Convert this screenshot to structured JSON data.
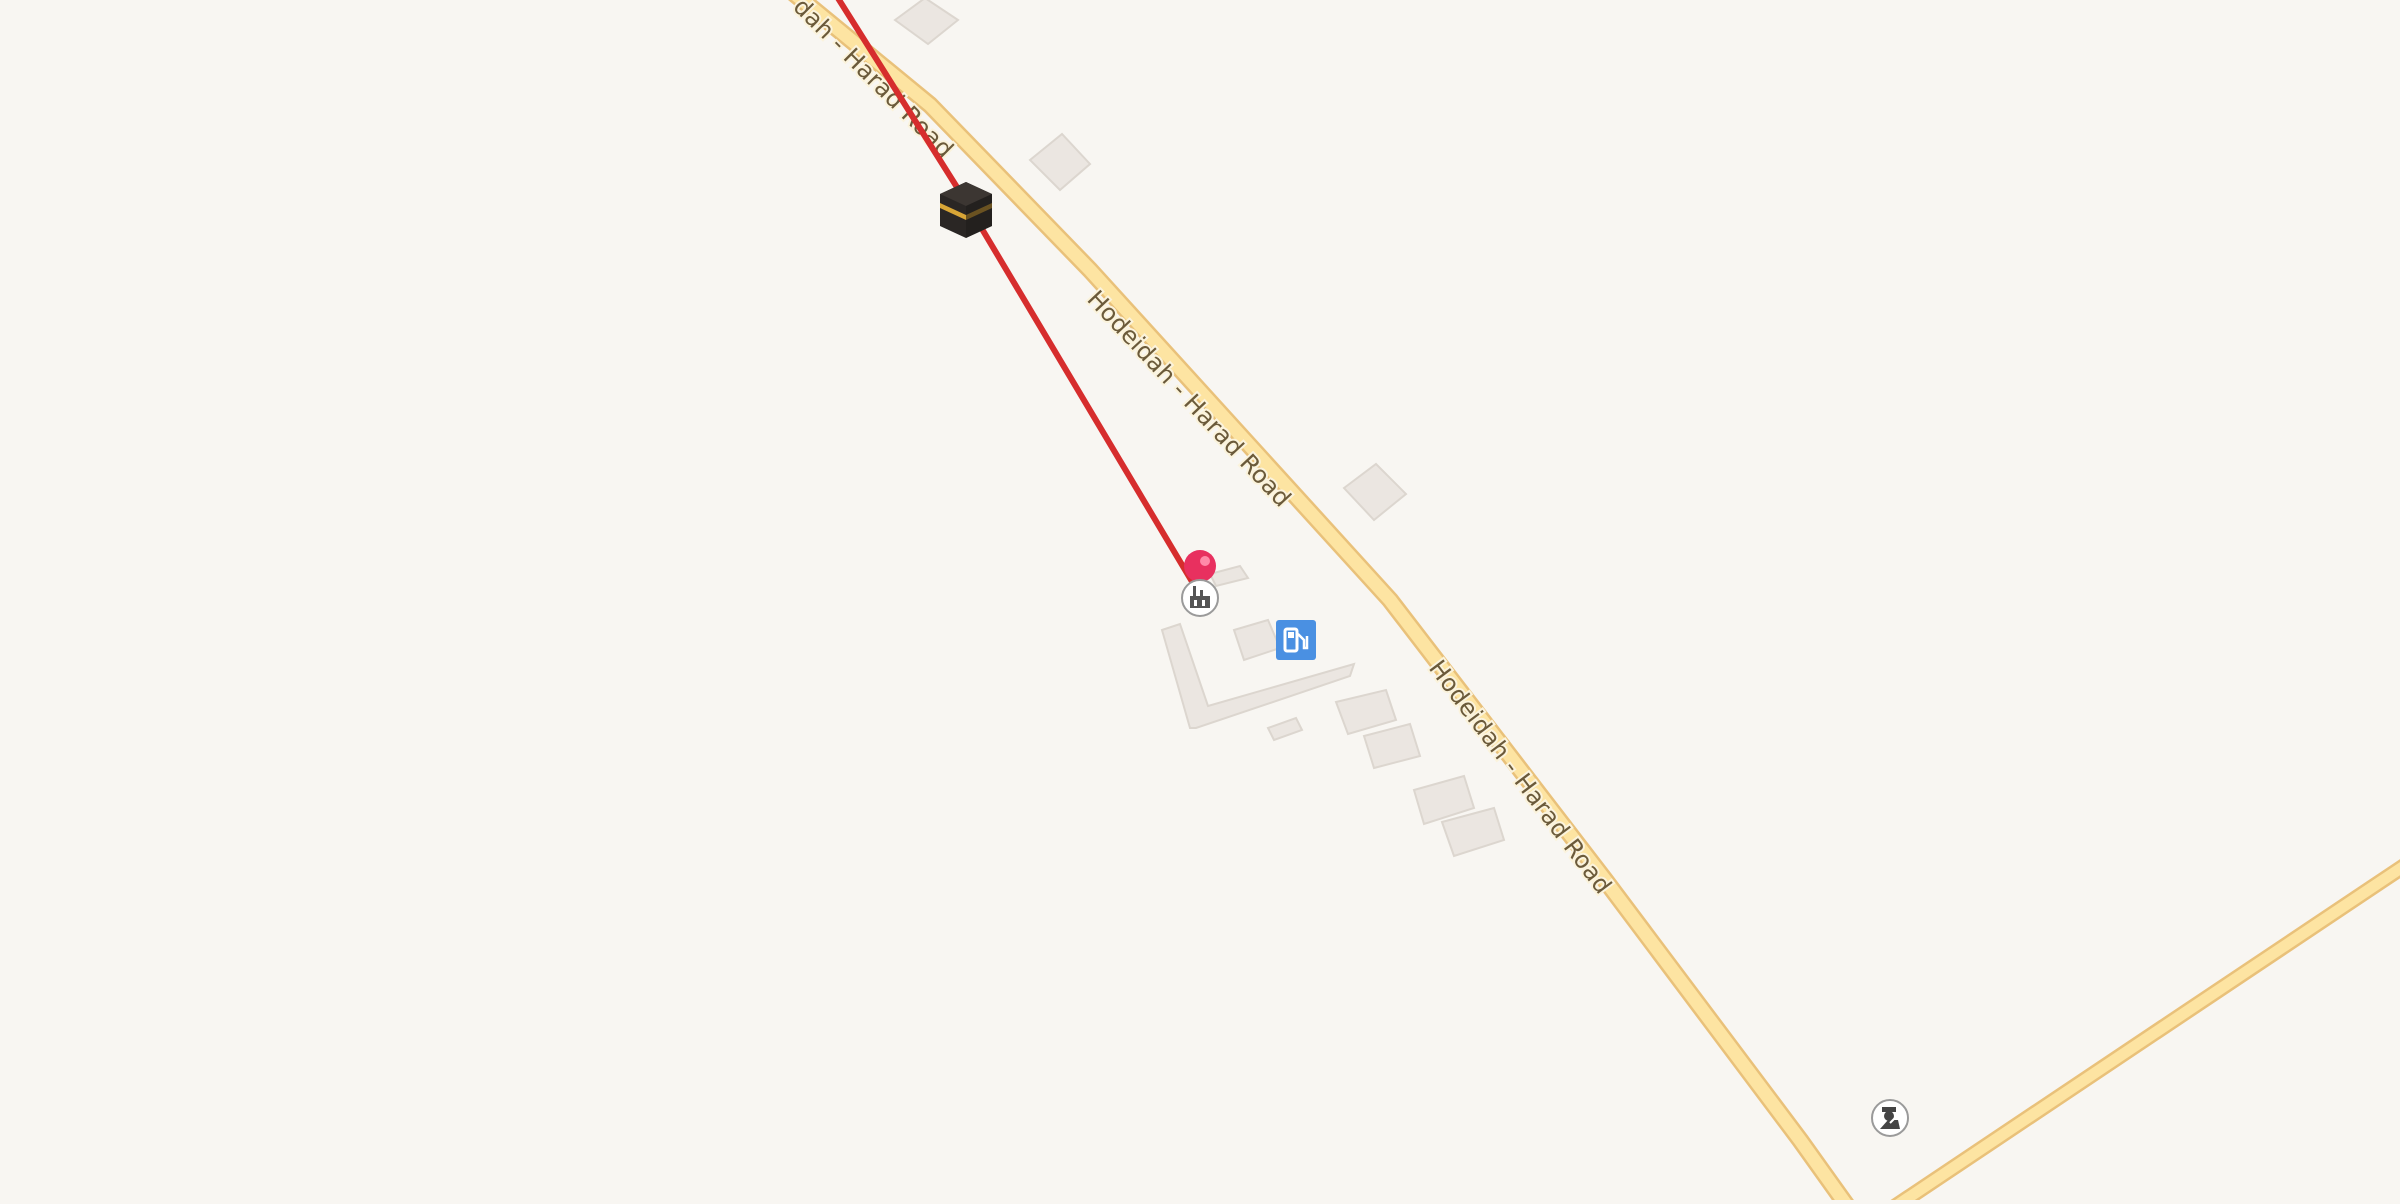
{
  "map": {
    "background": "#f8f6f2",
    "road_color": "#fde4a2",
    "road_casing": "#e9c17a",
    "building_color": "#ebe6e1",
    "building_shadow": "#d9d3cc",
    "route_color": "#d62d2d",
    "pin_color": "#e8305f",
    "fuel_badge_color": "#4a90e2",
    "roads": [
      {
        "name": "Hodeidah - Harad Road",
        "labels": [
          "dah - Harad Road",
          "Hodeidah - Harad Road",
          "Hodeidah - Harad Road"
        ]
      },
      {
        "name": "unnamed-road-east"
      }
    ],
    "markers": [
      {
        "name": "kaaba-icon",
        "type": "mosque-kaaba"
      },
      {
        "name": "dropped-pin-icon",
        "type": "pin"
      },
      {
        "name": "industrial-poi-icon",
        "type": "factory"
      },
      {
        "name": "fuel-station-icon",
        "type": "fuel"
      },
      {
        "name": "police-poi-icon",
        "type": "police"
      }
    ]
  }
}
